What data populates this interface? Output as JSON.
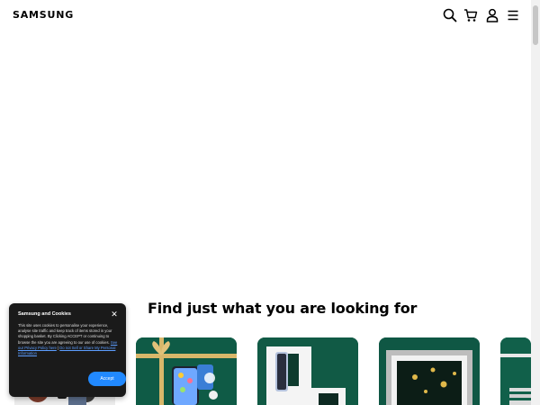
{
  "header": {
    "logo": "SAMSUNG",
    "icons": [
      "search-icon",
      "cart-icon",
      "account-icon",
      "menu-icon"
    ]
  },
  "main": {
    "section_title": "Find just what you are looking for",
    "cards": [
      {
        "name": "card-1"
      },
      {
        "name": "card-2"
      },
      {
        "name": "card-3"
      },
      {
        "name": "card-4"
      },
      {
        "name": "card-5"
      }
    ]
  },
  "cookie_banner": {
    "title": "Samsung and Cookies",
    "close_icon": "close-icon",
    "text": "This site uses cookies to personalise your experience, analyse site traffic and keep track of items stored in your shopping basket. By Clicking ACCEPT or continuing to browse the site you are agreeing to our use of cookies.",
    "privacy_link": "See our Privacy Policy here",
    "do_not_sell_link": "Do not Sell or Share My Personal Information",
    "accept_label": "Accept"
  },
  "colors": {
    "accent_blue": "#2189ff",
    "card_green": "#0f5b46",
    "cookie_bg": "#1a1a1a"
  }
}
